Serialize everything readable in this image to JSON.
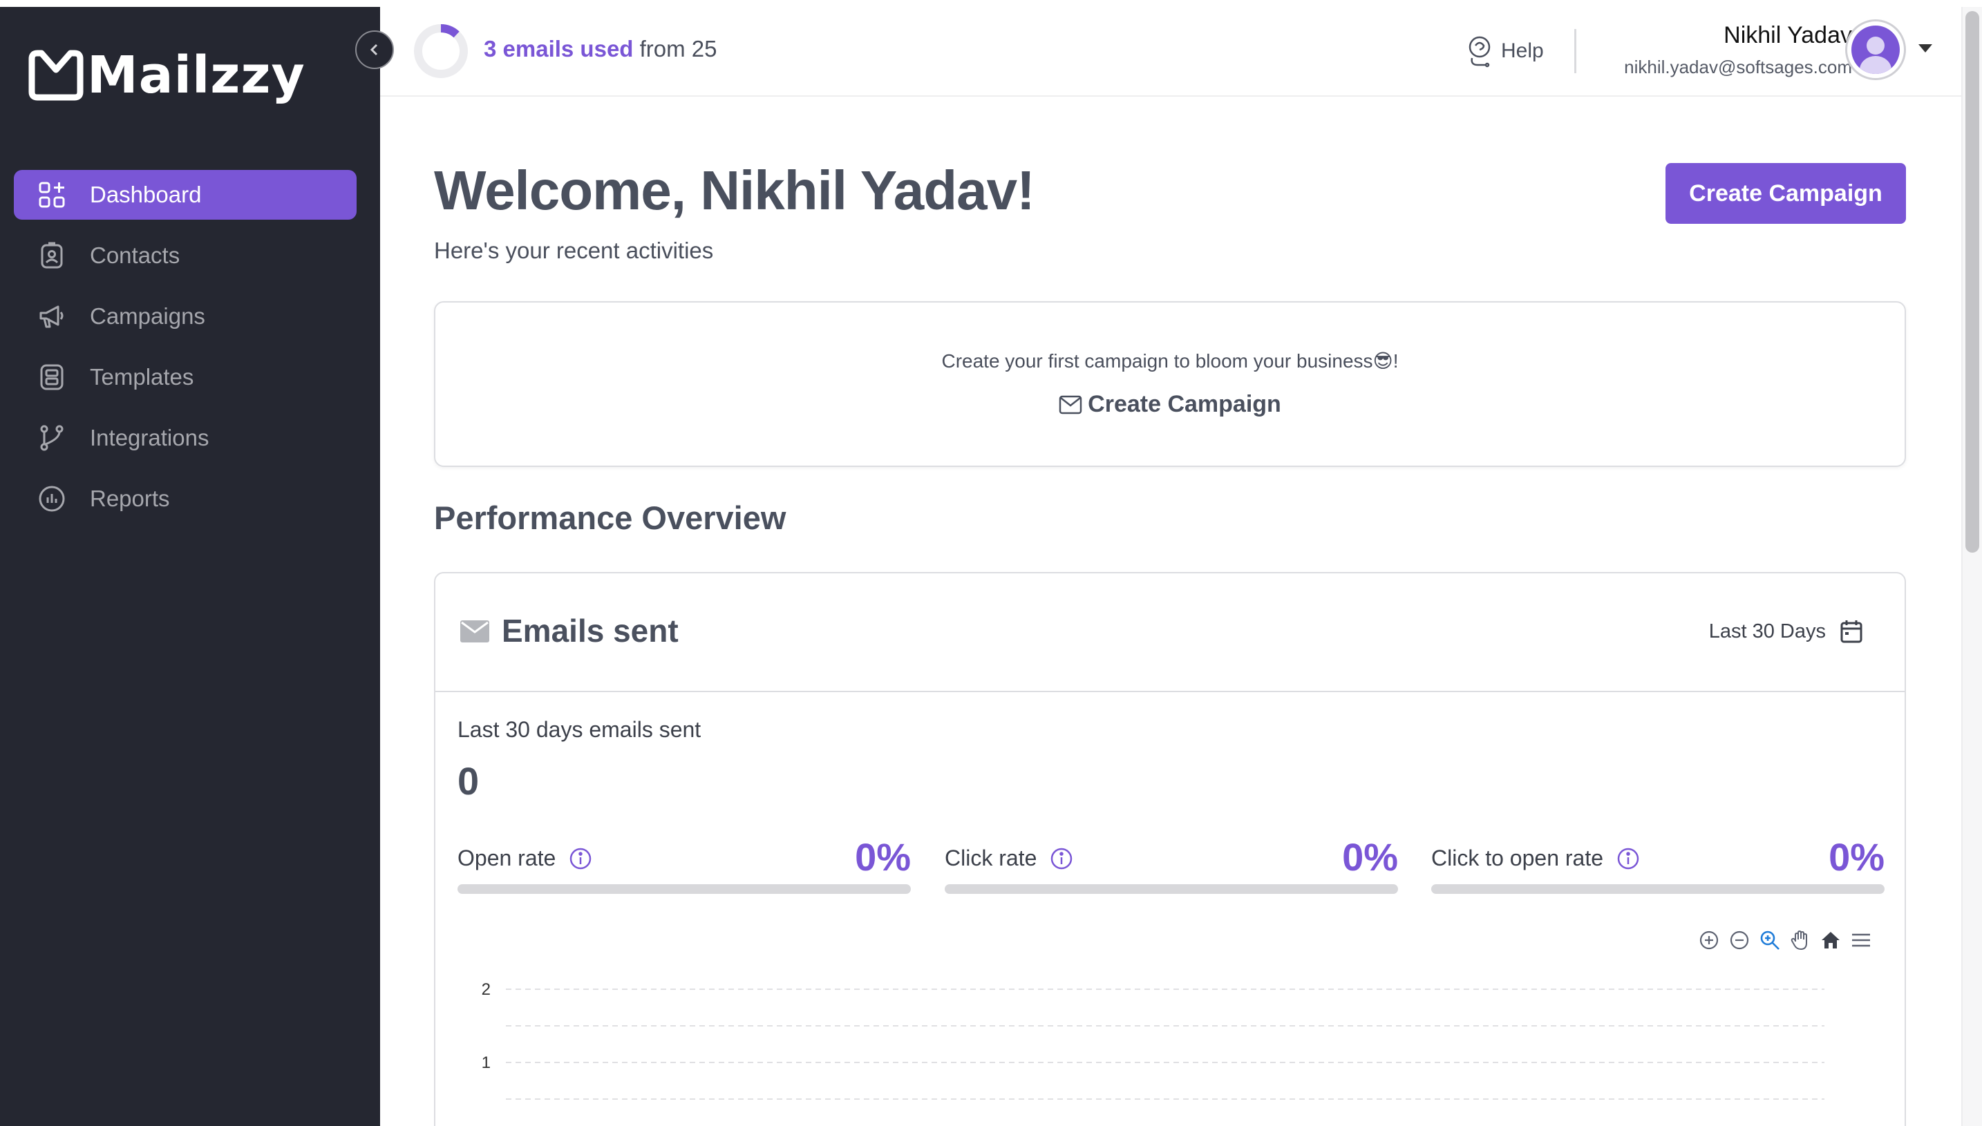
{
  "brand": {
    "name": "Mailzzy"
  },
  "sidebar": {
    "items": [
      {
        "label": "Dashboard",
        "icon": "dashboard-icon",
        "active": true
      },
      {
        "label": "Contacts",
        "icon": "contacts-icon"
      },
      {
        "label": "Campaigns",
        "icon": "megaphone-icon"
      },
      {
        "label": "Templates",
        "icon": "template-icon"
      },
      {
        "label": "Integrations",
        "icon": "branch-icon"
      },
      {
        "label": "Reports",
        "icon": "chart-icon"
      }
    ]
  },
  "header": {
    "usage": {
      "used_label": "3 emails used",
      "rest": " from 25",
      "used": 3,
      "total": 25
    },
    "help_label": "Help",
    "user": {
      "name": "Nikhil Yadav",
      "email": "nikhil.yadav@softsages.com"
    }
  },
  "main": {
    "welcome": "Welcome, Nikhil Yadav!",
    "subtitle": "Here's your recent activities",
    "create_button": "Create Campaign",
    "promo": {
      "text": "Create your first campaign to bloom your business😎!",
      "link_label": "Create Campaign"
    },
    "performance_title": "Performance Overview",
    "emails_card": {
      "title": "Emails sent",
      "range_label": "Last 30 Days",
      "stat_label": "Last 30 days emails sent",
      "stat_value": "0",
      "metrics": [
        {
          "label": "Open rate",
          "value": "0%",
          "fraction": 0
        },
        {
          "label": "Click rate",
          "value": "0%",
          "fraction": 0
        },
        {
          "label": "Click to open rate",
          "value": "0%",
          "fraction": 0
        }
      ]
    }
  },
  "colors": {
    "accent": "#7a56d6",
    "sidebar_bg": "#252731",
    "text_dark": "#4a505e",
    "track": "#d8d8db"
  },
  "chart_data": {
    "type": "line",
    "x": [],
    "series": [],
    "y_ticks": [
      "2",
      "1"
    ],
    "ylim": [
      0,
      2
    ],
    "grid": true
  }
}
